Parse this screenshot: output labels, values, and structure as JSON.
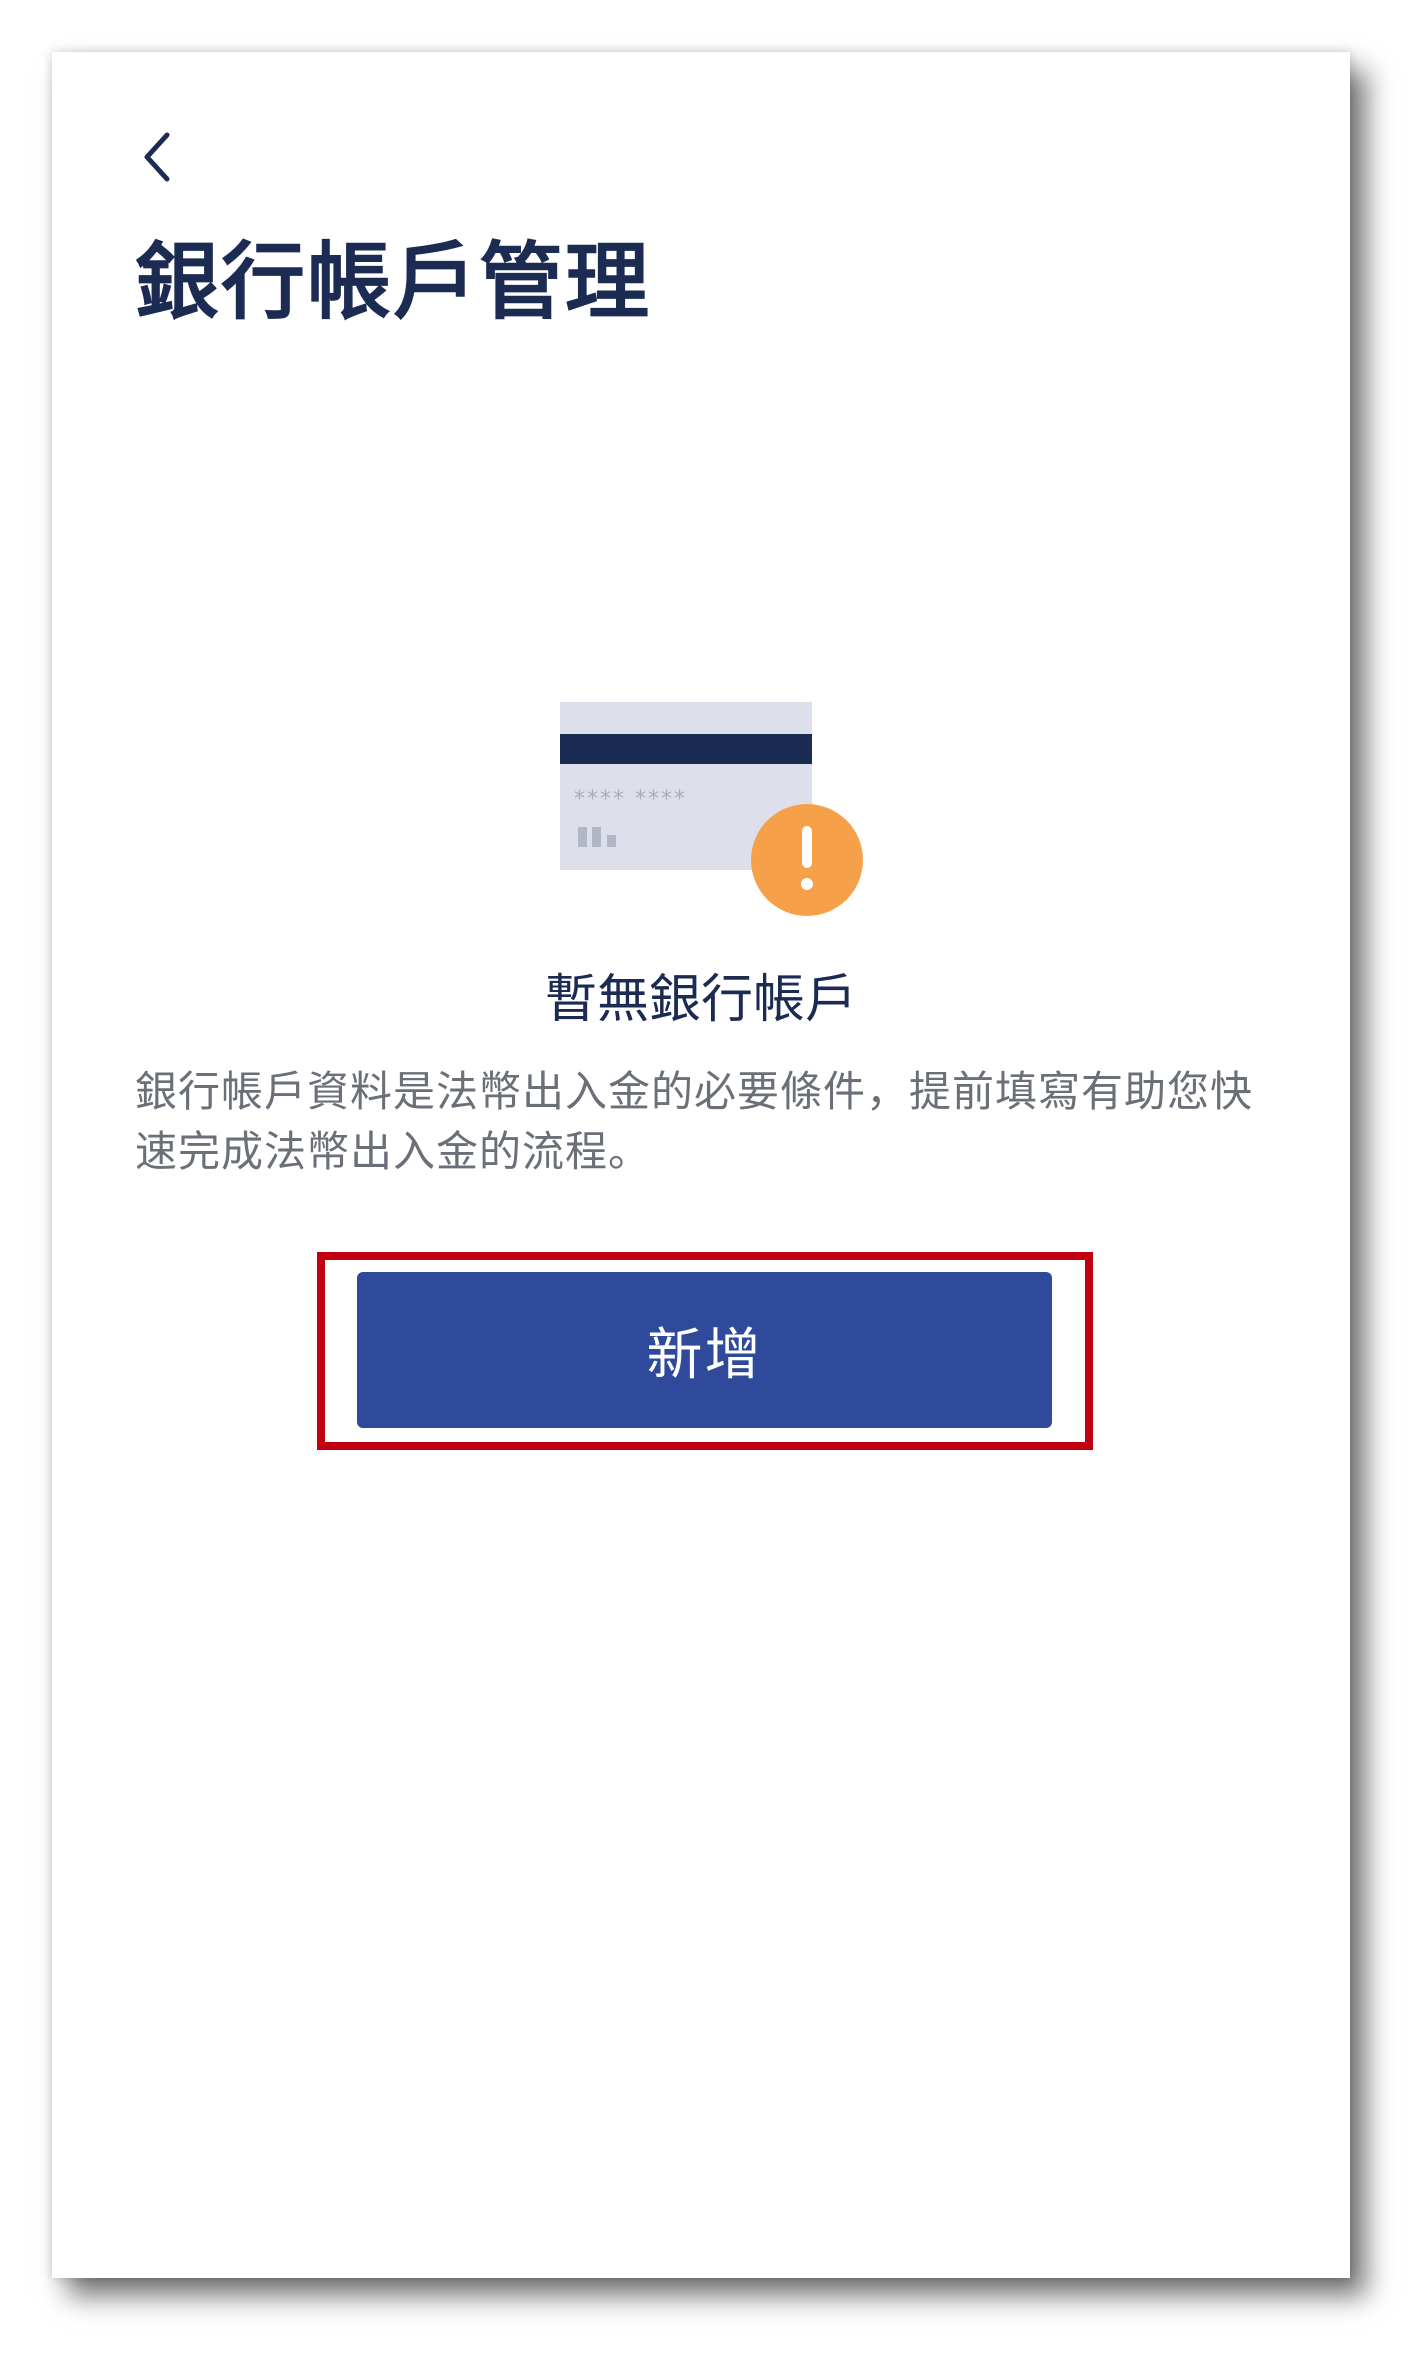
{
  "header": {
    "back_icon": "chevron-left-icon",
    "title": "銀行帳戶管理"
  },
  "empty_state": {
    "illustration": "bank-card-warning-icon",
    "card_masked_number": "**** ****",
    "title": "暫無銀行帳戶",
    "description": "銀行帳戶資料是法幣出入金的必要條件，提前填寫有助您快速完成法幣出入金的流程。"
  },
  "actions": {
    "add_label": "新增"
  },
  "colors": {
    "title": "#1b2b52",
    "primary_button": "#2f4a9a",
    "warning_badge": "#f7a04a",
    "card_stripe": "#1b2b52",
    "card_body": "#dde0ea",
    "highlight": "#c00010"
  }
}
